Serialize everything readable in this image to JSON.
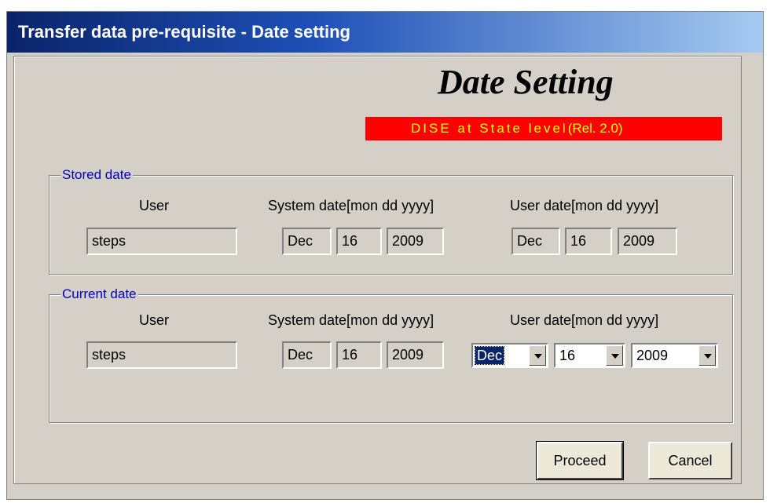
{
  "window": {
    "title": "Transfer data pre-requisite - Date setting",
    "heading": "Date Setting",
    "banner_text": "DISE at State level",
    "banner_release": "(Rel. 2.0)"
  },
  "stored": {
    "legend": "Stored date",
    "user_label": "User",
    "system_label": "System date[mon dd yyyy]",
    "userdate_label": "User date[mon dd yyyy]",
    "user": "steps",
    "system_mon": "Dec",
    "system_day": "16",
    "system_year": "2009",
    "user_mon": "Dec",
    "user_day": "16",
    "user_year": "2009"
  },
  "current": {
    "legend": "Current date",
    "user_label": "User",
    "system_label": "System date[mon dd yyyy]",
    "userdate_label": "User date[mon dd yyyy]",
    "user": "steps",
    "system_mon": "Dec",
    "system_day": "16",
    "system_year": "2009",
    "user_mon": "Dec",
    "user_day": "16",
    "user_year": "2009"
  },
  "buttons": {
    "proceed": "Proceed",
    "cancel": "Cancel"
  },
  "colors": {
    "banner_bg": "#ff0000",
    "banner_fg": "#ffff00",
    "legend": "#0000c0",
    "titlebar": "#0a246a"
  }
}
